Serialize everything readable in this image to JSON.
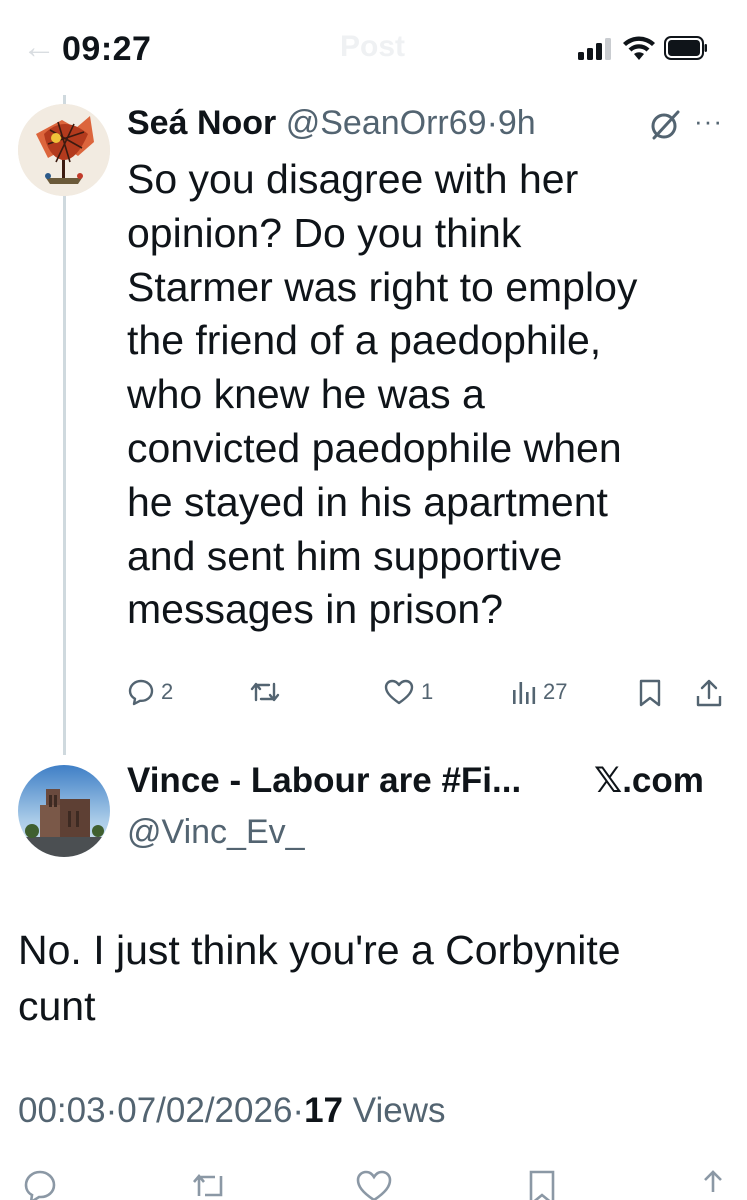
{
  "status_bar": {
    "time": "09:27",
    "header_title": "Post",
    "icons": [
      "back-arrow-icon",
      "cellular-signal-icon",
      "wifi-icon",
      "battery-icon"
    ]
  },
  "parent_tweet": {
    "display_name": "Seá Noor",
    "handle": "@SeanOrr69",
    "separator": "·",
    "age": "9h",
    "text": "So you disagree with her\nopinion? Do you think\nStarmer was right to employ\nthe friend of a paedophile,\nwho knew he was a\nconvicted paedophile when\nhe stayed in his apartment\nand sent him supportive\nmessages in prison?",
    "replies": "2",
    "reposts": "",
    "likes": "1",
    "views": "27"
  },
  "reply": {
    "display_name": "Vince - Labour are #Fi...",
    "handle": "@Vinc_Ev_",
    "badge": "𝕏.com",
    "text": "No. I just think you're a Corbynite\ncunt",
    "time": "00:03",
    "date": "07/02/2026",
    "separator": "·",
    "views_count": "17",
    "views_label": "Views"
  },
  "colors": {
    "text": "#0f1419",
    "muted": "#536471",
    "thread_line": "#cfd9de"
  }
}
